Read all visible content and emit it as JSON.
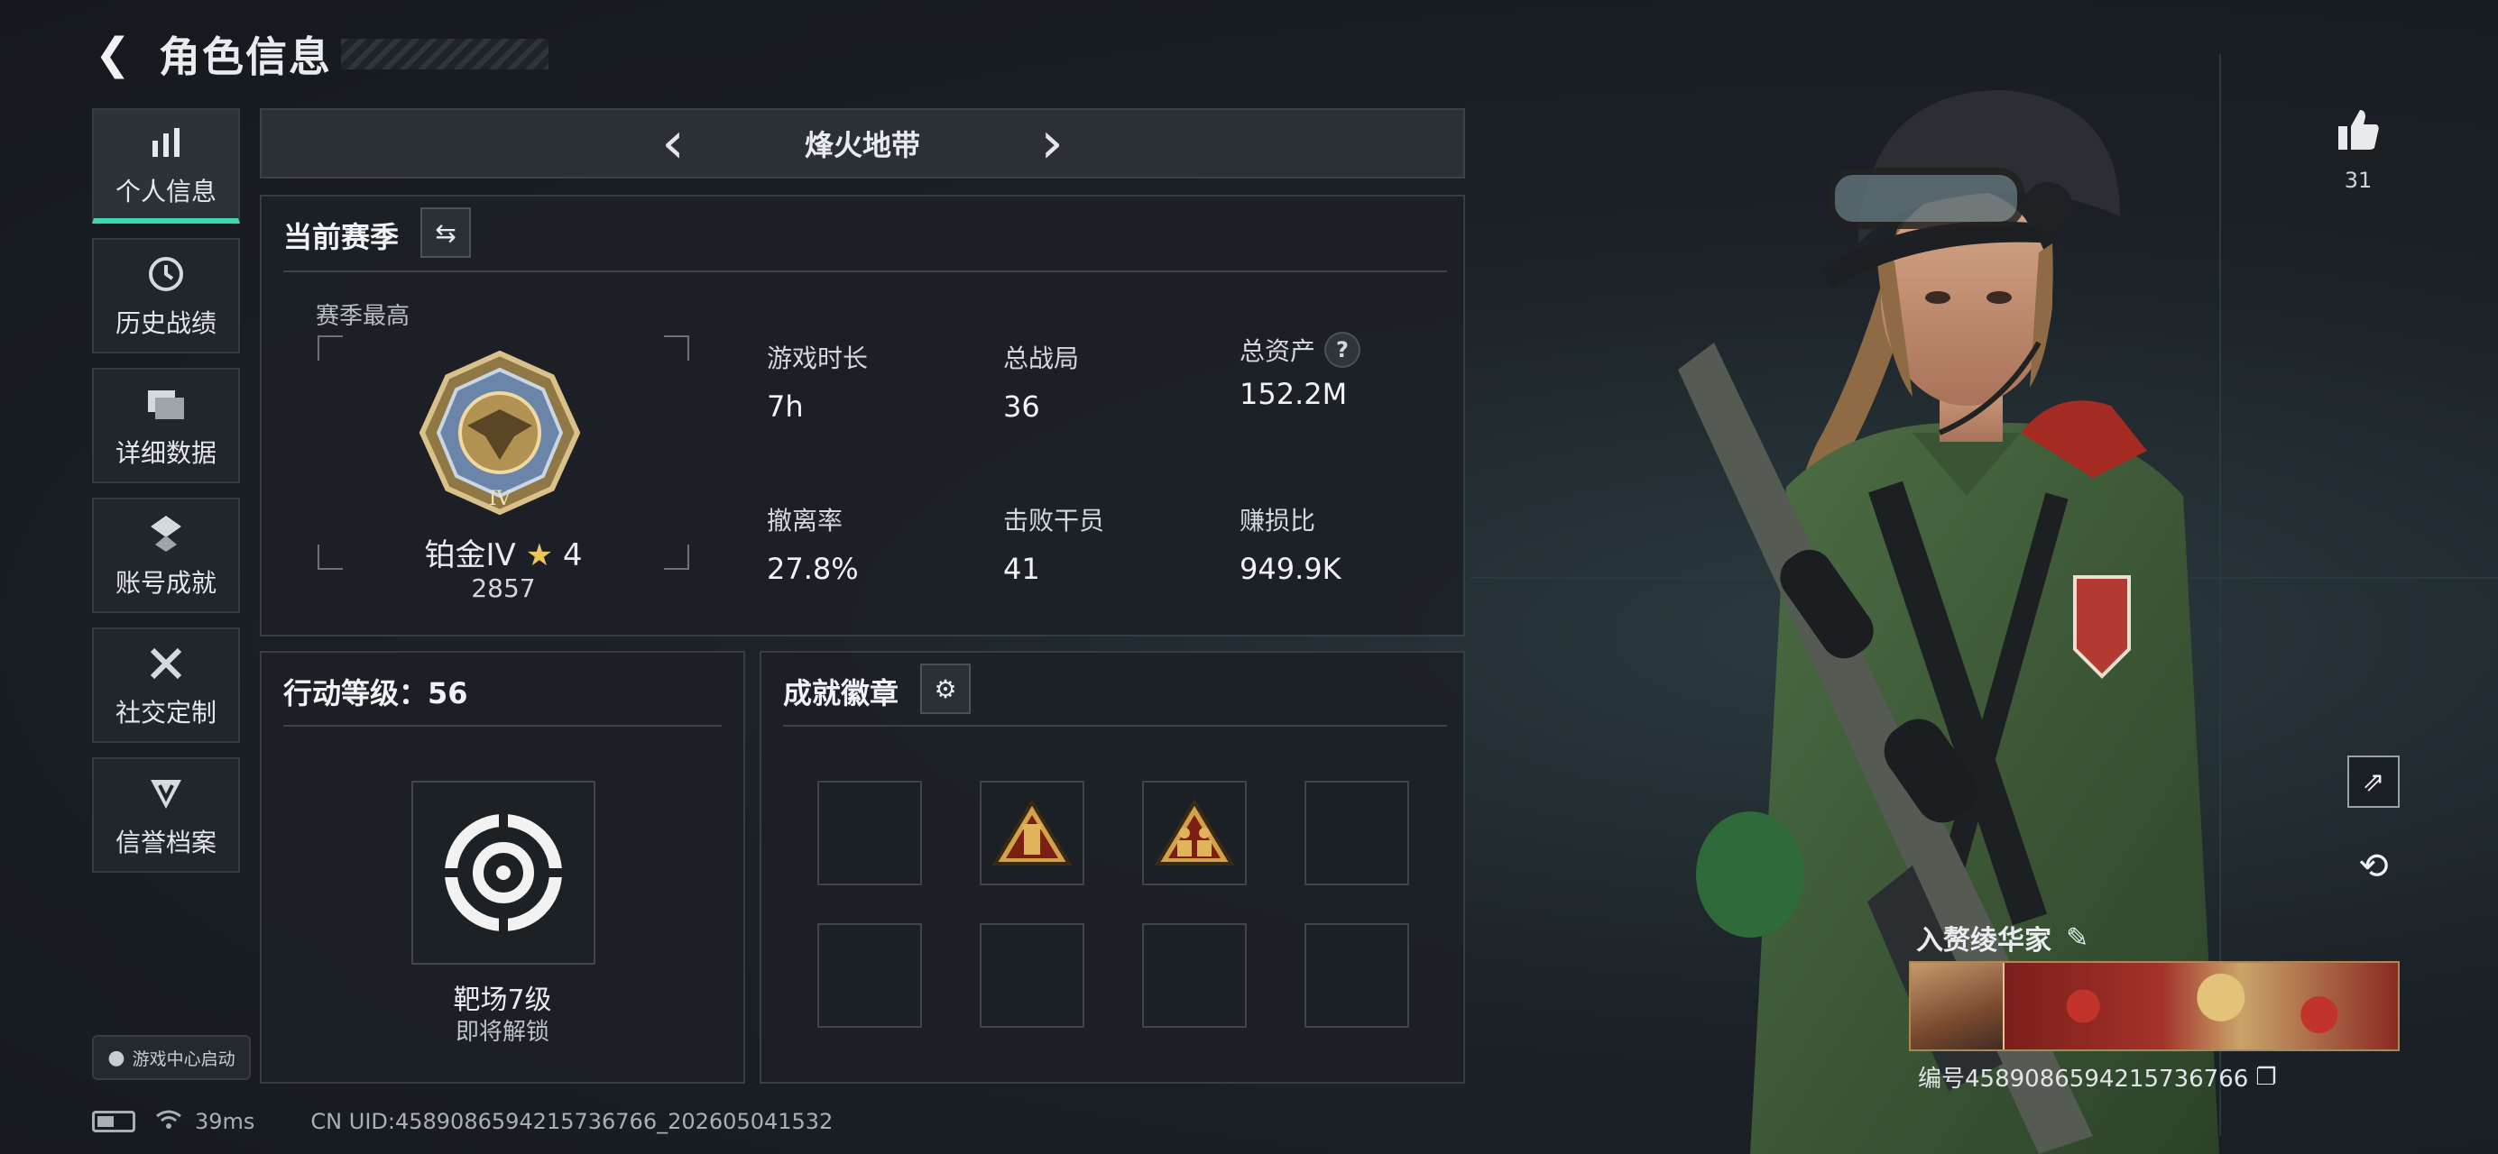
{
  "header": {
    "title": "角色信息"
  },
  "sidebar": {
    "items": [
      {
        "label": "个人信息",
        "icon": "bar-chart-icon",
        "glyph": "▮▮"
      },
      {
        "label": "历史战绩",
        "icon": "history-clock-icon",
        "glyph": "◷"
      },
      {
        "label": "详细数据",
        "icon": "folder-icon",
        "glyph": "▤"
      },
      {
        "label": "账号成就",
        "icon": "achievement-icon",
        "glyph": "✥"
      },
      {
        "label": "社交定制",
        "icon": "tools-icon",
        "glyph": "✕"
      },
      {
        "label": "信誉档案",
        "icon": "credit-shield-icon",
        "glyph": "⛉"
      }
    ],
    "active_index": 0,
    "game_center_label": "游戏中心启动"
  },
  "mode_selector": {
    "label": "烽火地带",
    "prev": "‹",
    "next": "›"
  },
  "season": {
    "title": "当前赛季",
    "best_label": "赛季最高",
    "rank_name": "铂金IV",
    "rank_star": "★",
    "rank_stars": "4",
    "rank_score": "2857",
    "medal_numeral": "IV",
    "stats": [
      {
        "label": "游戏时长",
        "value": "7h"
      },
      {
        "label": "总战局",
        "value": "36"
      },
      {
        "label": "总资产",
        "value": "152.2M",
        "help": "?"
      },
      {
        "label": "撤离率",
        "value": "27.8%"
      },
      {
        "label": "击败干员",
        "value": "41"
      },
      {
        "label": "赚损比",
        "value": "949.9K"
      }
    ]
  },
  "action_level": {
    "title": "行动等级：56",
    "unlock_name": "靶场7级",
    "unlock_status": "即将解锁"
  },
  "achievements": {
    "title": "成就徽章",
    "slots": [
      "empty",
      "badge-tower",
      "badge-squad",
      "empty",
      "empty",
      "empty",
      "empty",
      "empty"
    ]
  },
  "status_bar": {
    "ping": "39ms",
    "uid": "CN UID:4589086594215736766_202605041532"
  },
  "profile": {
    "likes": "31",
    "player_name": "入赘绫华家",
    "player_id": "编号4589086594215736766"
  },
  "colors": {
    "accent": "#3fd7b0",
    "gold": "#e8c65a",
    "panel": "#1c2126"
  }
}
